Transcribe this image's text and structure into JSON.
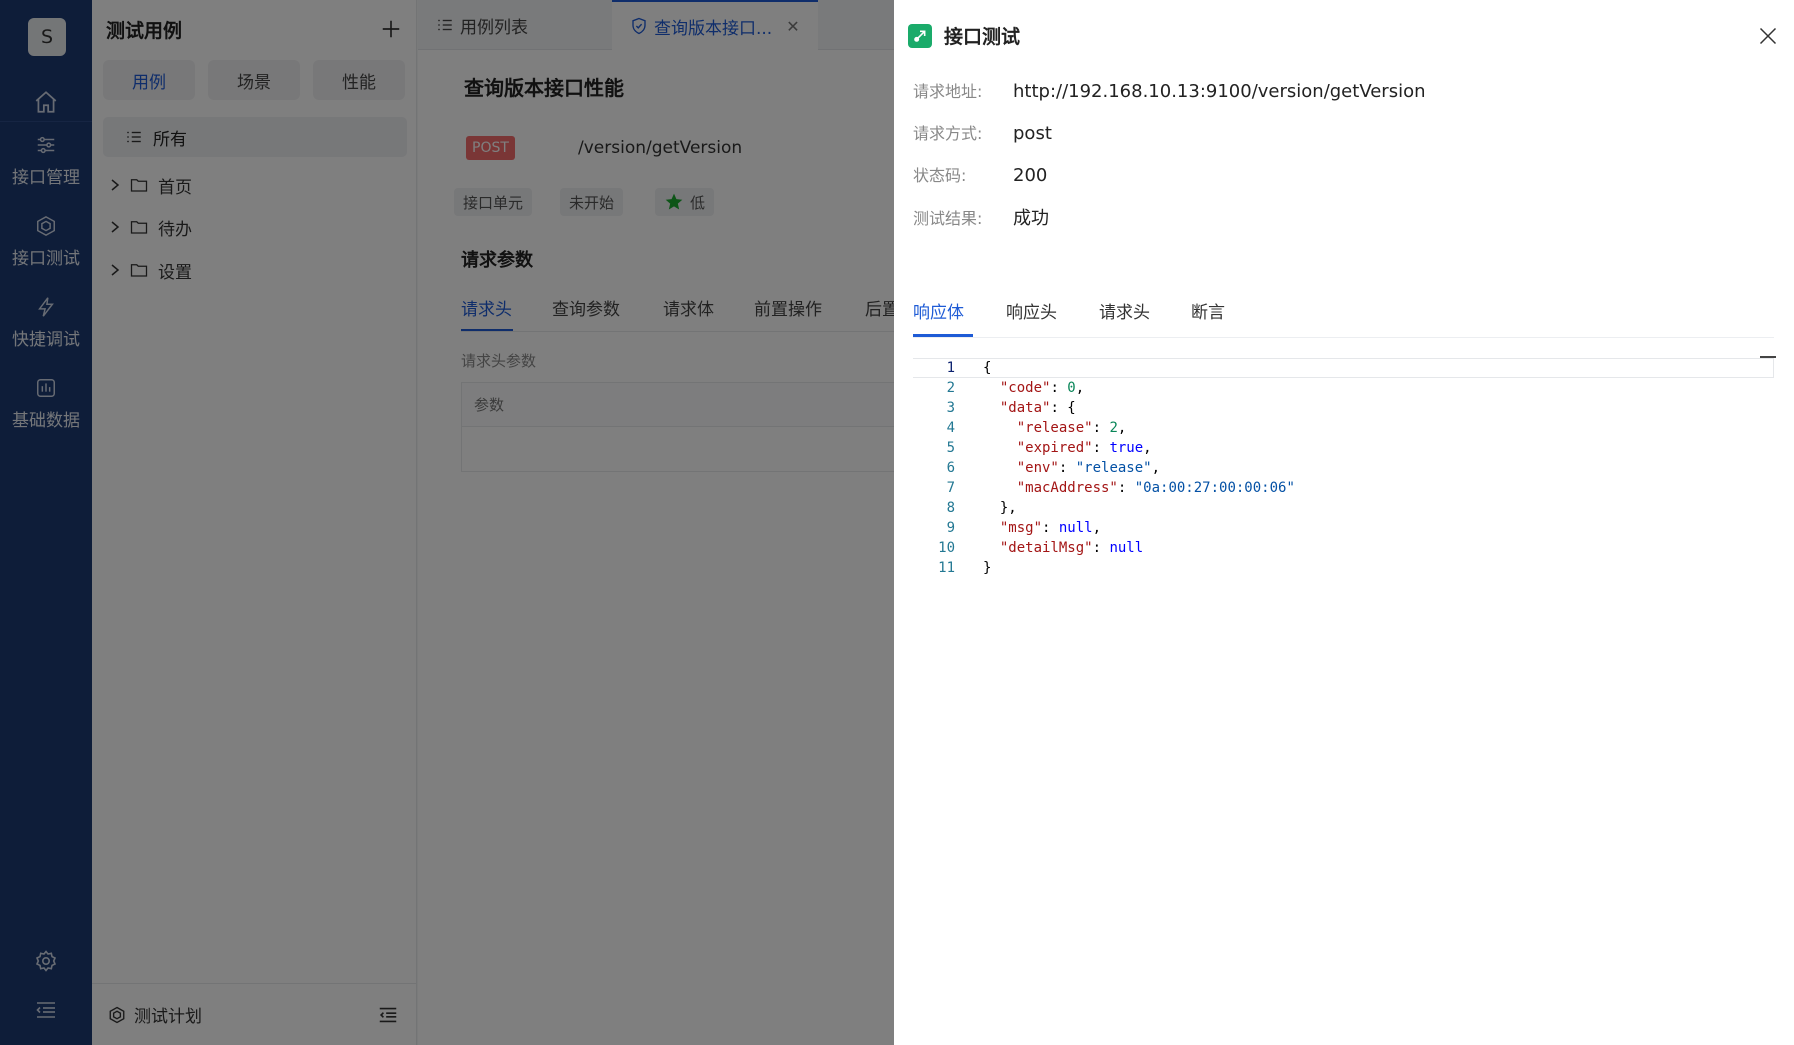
{
  "nav": {
    "avatar": "S",
    "items": [
      {
        "label": "接口管理",
        "icon": "sliders-icon"
      },
      {
        "label": "接口测试",
        "icon": "hexagon-icon"
      },
      {
        "label": "快捷调试",
        "icon": "lightning-icon"
      },
      {
        "label": "基础数据",
        "icon": "chart-box-icon"
      }
    ]
  },
  "tree": {
    "title": "测试用例",
    "segments": [
      "用例",
      "场景",
      "性能"
    ],
    "all_label": "所有",
    "nodes": [
      "首页",
      "待办",
      "设置"
    ],
    "footer_label": "测试计划"
  },
  "tabs": [
    {
      "label": "用例列表"
    },
    {
      "label": "查询版本接口..."
    }
  ],
  "case": {
    "title": "查询版本接口性能",
    "method": "POST",
    "path": "/version/getVersion",
    "chips": [
      "接口单元",
      "未开始",
      "低"
    ],
    "params_title": "请求参数",
    "param_tabs": [
      "请求头",
      "查询参数",
      "请求体",
      "前置操作",
      "后置"
    ],
    "header_params_label": "请求头参数",
    "header_table_col": "参数"
  },
  "drawer": {
    "title": "接口测试",
    "info": [
      {
        "label": "请求地址:",
        "value": "http://192.168.10.13:9100/version/getVersion"
      },
      {
        "label": "请求方式:",
        "value": "post"
      },
      {
        "label": "状态码:",
        "value": "200"
      },
      {
        "label": "测试结果:",
        "value": "成功"
      }
    ],
    "tabs": [
      "响应体",
      "响应头",
      "请求头",
      "断言"
    ],
    "line_numbers": [
      "1",
      "2",
      "3",
      "4",
      "5",
      "6",
      "7",
      "8",
      "9",
      "10",
      "11"
    ]
  },
  "colors": {
    "nav_bg": "#1c3a73",
    "accent": "#1e5bd6",
    "post_badge": "#f56c6c",
    "success_green": "#1aab6a"
  }
}
